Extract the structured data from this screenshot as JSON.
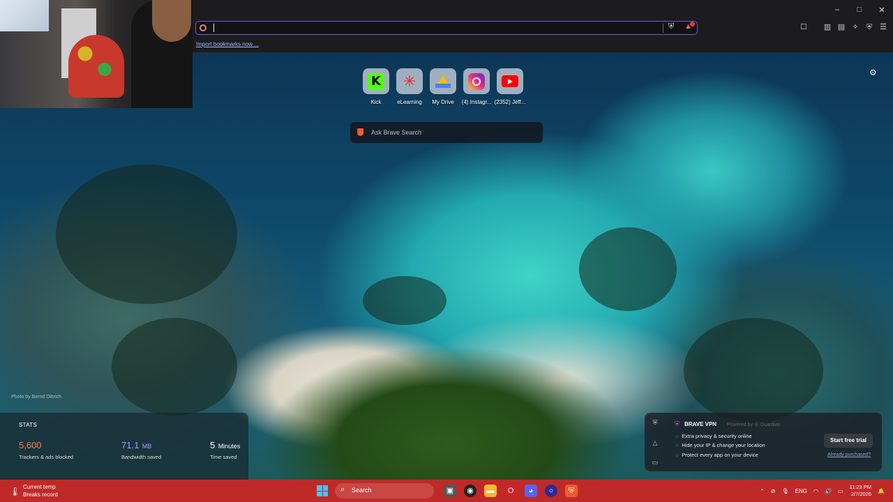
{
  "browser": {
    "window_controls": [
      "–",
      "□",
      "✕"
    ],
    "address_bar": {
      "value": ""
    },
    "import_link": "Import bookmarks now ...",
    "toolbar_icons": [
      "sidebar-icon",
      "wallet-icon",
      "leo-icon",
      "vpn-icon",
      "menu-icon"
    ]
  },
  "speed_dial": [
    {
      "label": "Kick",
      "icon": "kick-icon"
    },
    {
      "label": "eLearning",
      "icon": "elearning-icon"
    },
    {
      "label": "My Drive",
      "icon": "drive-icon"
    },
    {
      "label": "(4) Instagr...",
      "icon": "instagram-icon"
    },
    {
      "label": "(2352) Jeff...",
      "icon": "youtube-icon"
    }
  ],
  "search": {
    "placeholder": "Ask Brave Search"
  },
  "photo_credit": "Photo by Bernd Dittrich",
  "stats": {
    "title": "STATS",
    "items": [
      {
        "value": "5,600",
        "unit": "",
        "label": "Trackers & ads blocked",
        "color": "#ff7a45"
      },
      {
        "value": "71.1",
        "unit": "MB",
        "label": "Bandwidth saved",
        "color": "#a79bff"
      },
      {
        "value": "5",
        "unit": "Minutes",
        "label": "Time saved",
        "color": "#ffffff"
      }
    ]
  },
  "vpn": {
    "title": "BRAVE VPN",
    "powered": "Powered by Ⓖ Guardian",
    "features": [
      "Extra privacy & security online",
      "Hide your IP & change your location",
      "Protect every app on your device"
    ],
    "cta": "Start free trial",
    "purchased": "Already purchased?"
  },
  "taskbar": {
    "weather_title": "Current temp",
    "weather_sub": "Breaks record",
    "search_label": "Search",
    "language": "ENG",
    "time": "11:23 PM",
    "date": "2/7/2026",
    "accent": "#bf2a28"
  }
}
